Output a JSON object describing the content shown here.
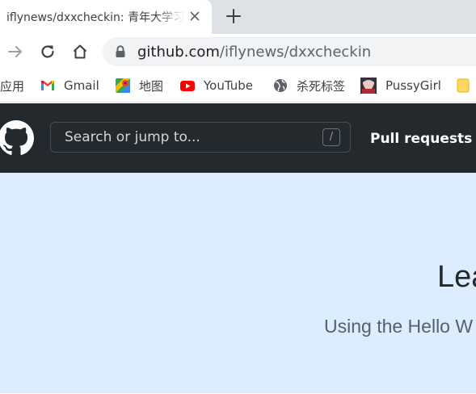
{
  "tab": {
    "title": "iflynews/dxxcheckin: 青年大学习",
    "close_icon": "close-icon",
    "new_tab_icon": "plus-icon"
  },
  "toolbar": {
    "icons": [
      "forward-arrow-icon",
      "reload-icon",
      "home-icon",
      "lock-icon"
    ],
    "url_host": "github.com",
    "url_path": "/iflynews/dxxcheckin"
  },
  "bookmarks": [
    {
      "label": "应用",
      "icon": "apps-grid-icon"
    },
    {
      "label": "Gmail",
      "icon": "gmail-icon"
    },
    {
      "label": "地图",
      "icon": "maps-icon"
    },
    {
      "label": "YouTube",
      "icon": "youtube-icon"
    },
    {
      "label": "杀死标签",
      "icon": "globe-icon"
    },
    {
      "label": "PussyGirl",
      "icon": "avatar-icon"
    },
    {
      "label": "",
      "icon": "folder-icon"
    }
  ],
  "github": {
    "search_placeholder": "Search or jump to...",
    "slash_key": "/",
    "nav_pull_requests": "Pull requests",
    "header_color": "#24292e"
  },
  "hero": {
    "title": "Lea",
    "subtitle": "Using the Hello W",
    "background": "#dbedff"
  }
}
